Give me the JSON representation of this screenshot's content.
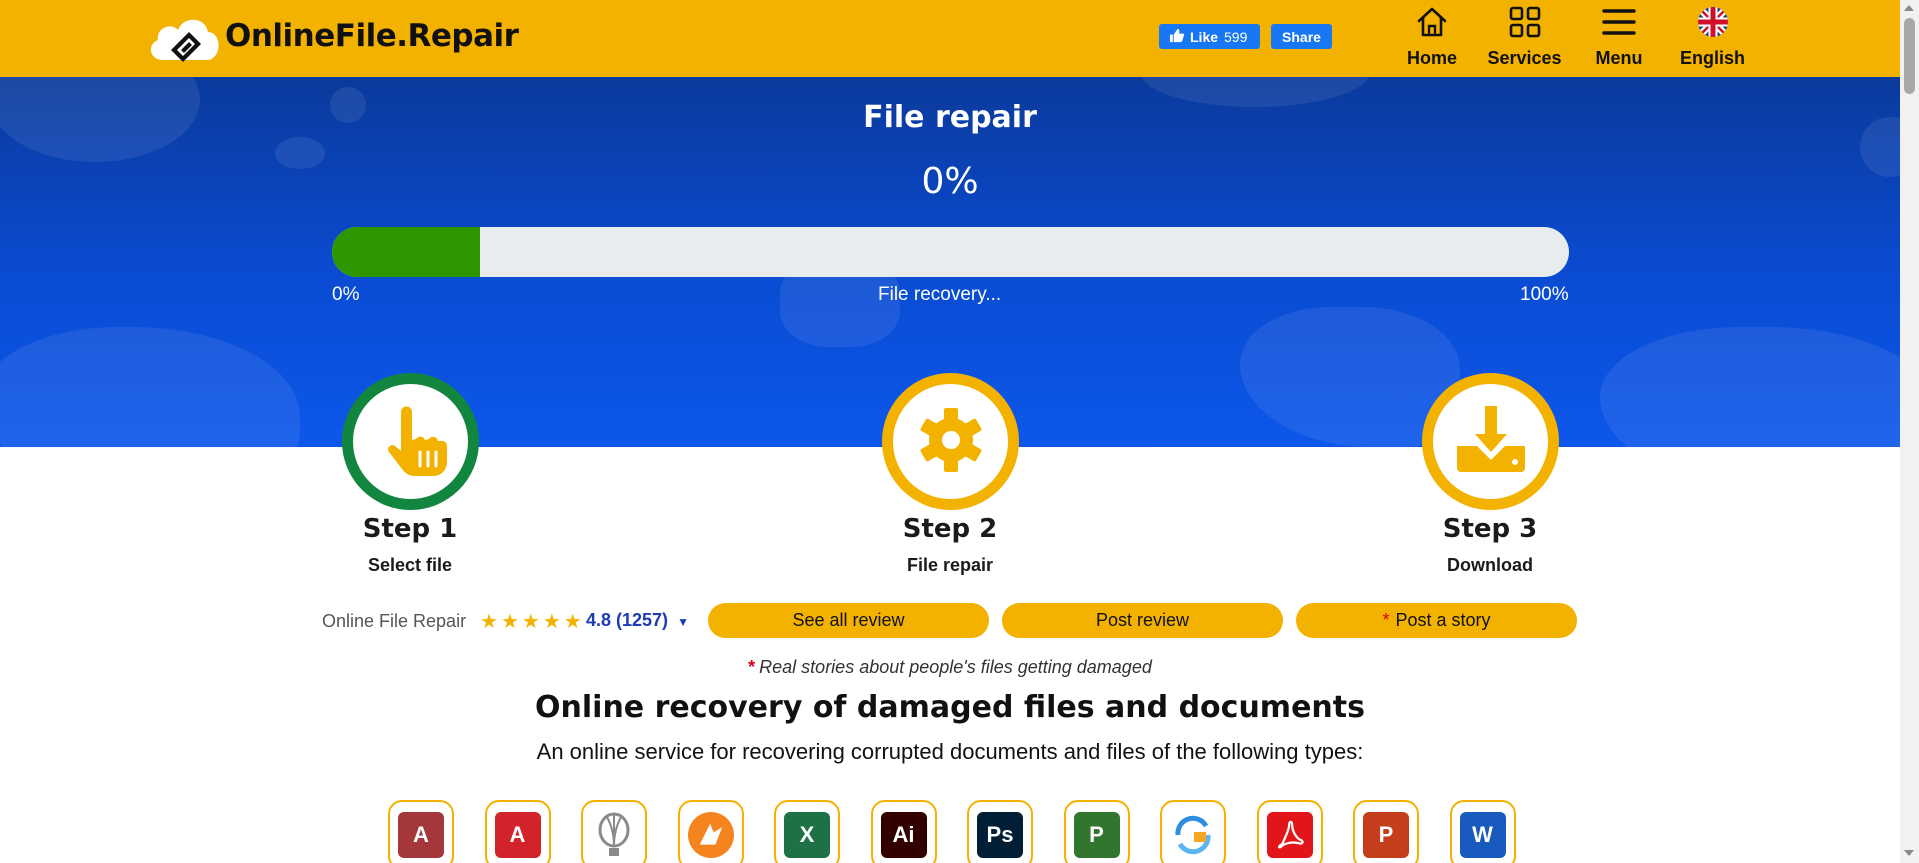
{
  "header": {
    "site_name": "OnlineFile.Repair",
    "fb_like_label": "Like",
    "fb_like_count": "599",
    "fb_share_label": "Share",
    "nav": [
      {
        "label": "Home",
        "icon": "home-icon"
      },
      {
        "label": "Services",
        "icon": "grid-icon"
      },
      {
        "label": "Menu",
        "icon": "hamburger-icon"
      },
      {
        "label": "English",
        "icon": "uk-flag-icon"
      }
    ]
  },
  "hero": {
    "title": "File repair",
    "percent_text": "0%",
    "progress_fraction": 0.12,
    "progress_min_label": "0%",
    "progress_status": "File recovery...",
    "progress_max_label": "100%"
  },
  "steps": [
    {
      "title": "Step 1",
      "subtitle": "Select file",
      "icon": "pointer-hand-icon",
      "ring_color": "#12863f"
    },
    {
      "title": "Step 2",
      "subtitle": "File repair",
      "icon": "gear-icon",
      "ring_color": "#f3b200"
    },
    {
      "title": "Step 3",
      "subtitle": "Download",
      "icon": "download-icon",
      "ring_color": "#f3b200"
    }
  ],
  "rating": {
    "label": "Online File Repair",
    "stars": 5,
    "score_text": "4.8 (1257)",
    "buttons": [
      {
        "label": "See all review"
      },
      {
        "label": "Post review"
      },
      {
        "label": "Post a story",
        "required_mark": "*"
      }
    ]
  },
  "note": {
    "mark": "*",
    "text": "Real stories about people's files getting damaged"
  },
  "section": {
    "title": "Online recovery of damaged files and documents",
    "subtitle": "An online service for recovering corrupted documents and files of the following types:"
  },
  "file_types": [
    {
      "icon": "access-icon",
      "glyph": "A",
      "color": "#a4373a"
    },
    {
      "icon": "autocad-icon",
      "glyph": "A",
      "color": "#d3232a"
    },
    {
      "icon": "coreldraw-icon",
      "glyph": "",
      "color": "#9a9a9a"
    },
    {
      "icon": "firebird-icon",
      "glyph": "",
      "color": "#f5841f"
    },
    {
      "icon": "excel-icon",
      "glyph": "X",
      "color": "#1e7145"
    },
    {
      "icon": "illustrator-icon",
      "glyph": "Ai",
      "color": "#330000"
    },
    {
      "icon": "photoshop-icon",
      "glyph": "Ps",
      "color": "#001e36"
    },
    {
      "icon": "project-icon",
      "glyph": "P",
      "color": "#31752f"
    },
    {
      "icon": "outlook-sync-icon",
      "glyph": "",
      "color": "#2e8de0"
    },
    {
      "icon": "pdf-icon",
      "glyph": "",
      "color": "#e2151b"
    },
    {
      "icon": "powerpoint-icon",
      "glyph": "P",
      "color": "#c43e1c"
    },
    {
      "icon": "word-icon",
      "glyph": "W",
      "color": "#185abd"
    }
  ],
  "colors": {
    "brand_yellow": "#f3b200",
    "hero_blue": "#0a4cd3",
    "progress_green": "#2e9600",
    "step_green": "#12863f",
    "rating_blue": "#1c3bb5"
  }
}
